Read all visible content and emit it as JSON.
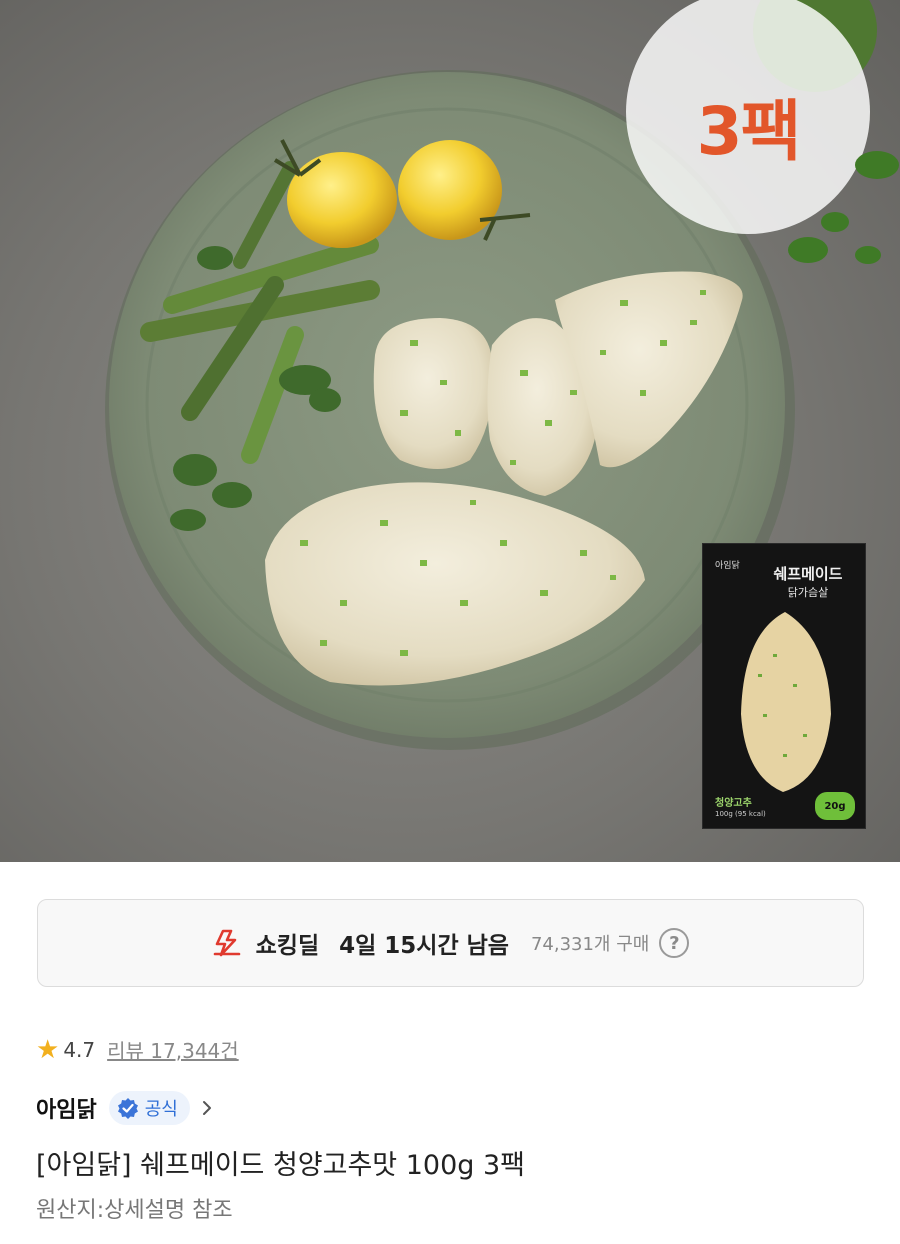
{
  "hero": {
    "pack_badge": "3팩",
    "product_box": {
      "brand": "아임닭",
      "title": "쉐프메이드",
      "subtitle": "닭가슴살",
      "flavor": "청양고추",
      "weight": "100g (95 kcal)",
      "protein": "20g"
    }
  },
  "deal": {
    "icon": "lightning-icon",
    "label": "쇼킹딜",
    "time_left": "4일 15시간 남음",
    "purchase_count": "74,331개 구매",
    "help_glyph": "?"
  },
  "rating": {
    "star_glyph": "★",
    "value": "4.7",
    "review_text": "리뷰 17,344건"
  },
  "seller": {
    "name": "아임닭",
    "badge_label": "공식",
    "badge_color": "#2f6fd6"
  },
  "product": {
    "title": "[아임닭] 쉐프메이드 청양고추맛 100g 3팩",
    "origin": "원산지:상세설명 참조"
  },
  "colors": {
    "accent_orange": "#e2562a",
    "deal_red": "#e03a2f",
    "star": "#f2b01e"
  }
}
